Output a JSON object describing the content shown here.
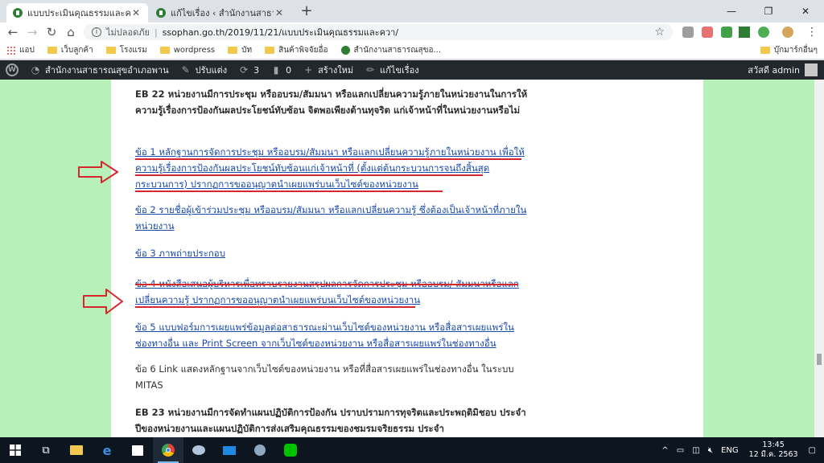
{
  "browser": {
    "tabs": [
      {
        "title": "แบบประเมินคุณธรรมและความโปร่งใสฯ",
        "active": true
      },
      {
        "title": "แก้ไขเรื่อง ‹ สำนักงานสาธารณสุขอำเภ",
        "active": false
      }
    ],
    "address": {
      "security_label": "ไม่ปลอดภัย",
      "url": "ssophan.go.th/2019/11/21/แบบประเมินคุณธรรมและควา/"
    },
    "bookmarks": [
      {
        "label": "แอป",
        "icon": "apps-grid-icon"
      },
      {
        "label": "เว็บลูกค้า",
        "icon": "folder-icon"
      },
      {
        "label": "โรงแรม",
        "icon": "folder-icon"
      },
      {
        "label": "wordpress",
        "icon": "folder-icon"
      },
      {
        "label": "บัท",
        "icon": "folder-icon"
      },
      {
        "label": "สินค้าพิจจัยอื่อ",
        "icon": "folder-icon"
      },
      {
        "label": "สำนักงานสาธารณสุขอ...",
        "icon": "site-favicon"
      }
    ],
    "bookmarks_other": "บุ๊กมาร์กอื่นๆ"
  },
  "adminbar": {
    "site_name": "สำนักงานสาธารณสุขอำเภอพาน",
    "customize": "ปรับแต่ง",
    "updates_count": "3",
    "comments_count": "0",
    "new_label": "สร้างใหม่",
    "edit_label": "แก้ไขเรื่อง",
    "greeting": "สวัสดี admin"
  },
  "article": {
    "eb22": "EB 22 หน่วยงานมีการประชุม หรืออบรม/สัมมนา หรือแลกเปลี่ยนความรู้ภายในหน่วยงานในการให้ความรู้เรื่องการป้องกันผลประโยชน์ทับซ้อน จิตพอเพียงต้านทุจริต แก่เจ้าหน้าที่ในหน่วยงานหรือไม่",
    "item1": "ข้อ 1 หลักฐานการจัดการประชุม หรืออบรม/สัมมนา หรือแลกเปลี่ยนความรู้ภายในหน่วยงาน เพื่อให้ความรู้เรื่องการป้องกันผลประโยชน์ทับซ้อนแก่เจ้าหน้าที่ (ตั้งแต่ต้นกระบวนการจนถึงสิ้นสุดกระบวนการ) ปรากฏการขออนุญาตนำเผยแพร่บนเว็บไซต์ของหน่วยงาน",
    "item2": "ข้อ 2 รายชื่อผู้เข้าร่วมประชุม หรืออบรม/สัมมนา หรือแลกเปลี่ยนความรู้ ซึ่งต้องเป็นเจ้าหน้าที่ภายในหน่วยงาน",
    "item3": "ข้อ 3 ภาพถ่ายประกอบ",
    "item4": "ข้อ 4 หนังสือเสนอผู้บริหารเพื่อทราบรายงานสรุปผลการจัดการประชุม หรืออบรม/ สัมมนาหรือแลกเปลี่ยนความรู้ ปรากฏการขออนุญาตนำเผยแพร่บนเว็บไซต์ของหน่วยงาน",
    "item5": "ข้อ 5 แบบฟอร์มการเผยแพร่ข้อมูลต่อสาธารณะผ่านเว็บไซต์ของหน่วยงาน หรือสื่อสารเผยแพร่ในช่องทางอื่น และ Print Screen จากเว็บไซต์ของหน่วยงาน หรือสื่อสารเผยแพร่ในช่องทางอื่น",
    "item6": "ข้อ 6 Link แสดงหลักฐานจากเว็บไซต์ของหน่วยงาน หรือที่สื่อสารเผยแพร่ในช่องทางอื่น ในระบบ MITAS",
    "eb23": "EB 23 หน่วยงานมีการจัดทำแผนปฏิบัติการป้องกัน ปราบปรามการทุจริตและประพฤติมิชอบ ประจำปีของหน่วยงานและแผนปฏิบัติการส่งเสริมคุณธรรมของชมรมจริยธรรม ประจำ"
  },
  "taskbar": {
    "language": "ENG",
    "time": "13:45",
    "date": "12 มี.ค. 2563"
  },
  "colors": {
    "page_background": "#b7f0b9",
    "link": "#1a4aa8",
    "annotation_red": "#d7262e",
    "admin_bar": "#23282d"
  }
}
